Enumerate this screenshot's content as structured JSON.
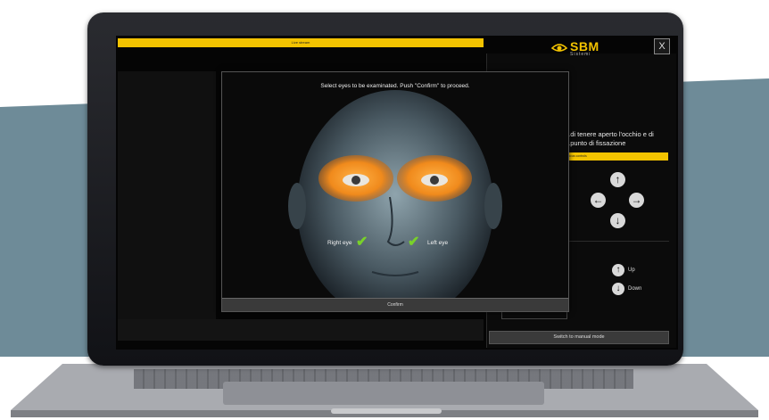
{
  "app": {
    "brand": "SBM",
    "brand_sub": "Sistemi",
    "close_label": "X",
    "top_bar_label": "Live stream"
  },
  "side_panel": {
    "instruction": "...di tenere aperto l'occhio e di ...punto di fissazione",
    "yellow_bar_label": "Focus controls",
    "up_label": "Up",
    "down_label": "Down",
    "manual_button": "Switch to manual mode"
  },
  "dialog": {
    "title": "Select eyes to be examinated. Push \"Confirm\" to proceed.",
    "right_eye_label": "Right eye",
    "left_eye_label": "Left eye",
    "confirm_button": "Confirm"
  },
  "icons": {
    "arrow_up": "arrow-up-icon",
    "arrow_down": "arrow-down-icon",
    "arrow_left": "arrow-left-icon",
    "arrow_right": "arrow-right-icon",
    "check": "check-icon"
  },
  "colors": {
    "accent": "#f3c300",
    "check": "#79d12a",
    "eye_highlight": "#f08a1c",
    "background_band": "#6e8b98"
  }
}
